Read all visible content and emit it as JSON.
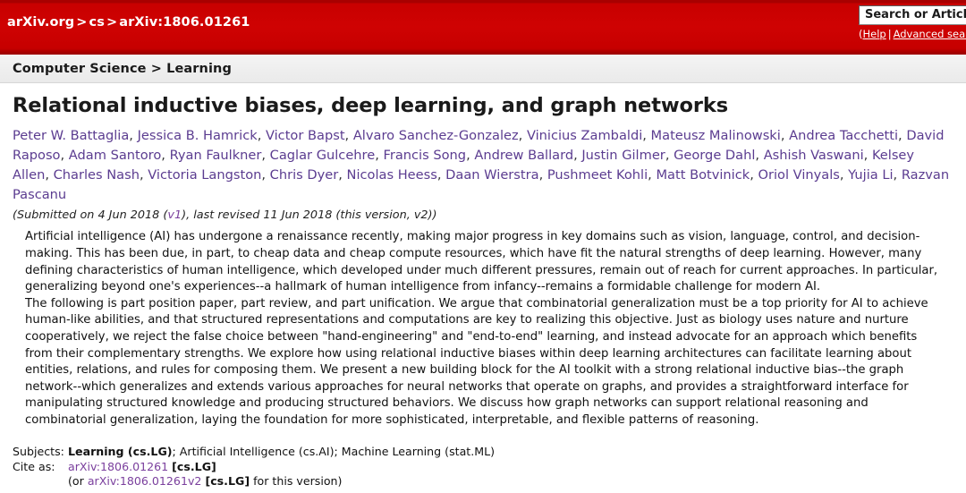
{
  "header": {
    "breadcrumb": {
      "site": "arXiv.org",
      "sep1": ">",
      "archive": "cs",
      "sep2": ">",
      "identifier": "arXiv:1806.01261"
    },
    "search": {
      "value": "Search or Article-id",
      "open_paren": "(",
      "help_label": "Help",
      "pipe": "|",
      "advanced_label": "Advanced search"
    }
  },
  "subject_bar": {
    "text": "Computer Science > Learning"
  },
  "paper": {
    "title": "Relational inductive biases, deep learning, and graph networks",
    "authors": [
      "Peter W. Battaglia",
      "Jessica B. Hamrick",
      "Victor Bapst",
      "Alvaro Sanchez-Gonzalez",
      "Vinicius Zambaldi",
      "Mateusz Malinowski",
      "Andrea Tacchetti",
      "David Raposo",
      "Adam Santoro",
      "Ryan Faulkner",
      "Caglar Gulcehre",
      "Francis Song",
      "Andrew Ballard",
      "Justin Gilmer",
      "George Dahl",
      "Ashish Vaswani",
      "Kelsey Allen",
      "Charles Nash",
      "Victoria Langston",
      "Chris Dyer",
      "Nicolas Heess",
      "Daan Wierstra",
      "Pushmeet Kohli",
      "Matt Botvinick",
      "Oriol Vinyals",
      "Yujia Li",
      "Razvan Pascanu"
    ],
    "submitted": {
      "prefix": "(Submitted on 4 Jun 2018 (",
      "v1_link": "v1",
      "suffix": "), last revised 11 Jun 2018 (this version, v2))"
    },
    "abstract": [
      "Artificial intelligence (AI) has undergone a renaissance recently, making major progress in key domains such as vision, language, control, and decision-making. This has been due, in part, to cheap data and cheap compute resources, which have fit the natural strengths of deep learning. However, many defining characteristics of human intelligence, which developed under much different pressures, remain out of reach for current approaches. In particular, generalizing beyond one's experiences--a hallmark of human intelligence from infancy--remains a formidable challenge for modern AI.",
      "The following is part position paper, part review, and part unification. We argue that combinatorial generalization must be a top priority for AI to achieve human-like abilities, and that structured representations and computations are key to realizing this objective. Just as biology uses nature and nurture cooperatively, we reject the false choice between \"hand-engineering\" and \"end-to-end\" learning, and instead advocate for an approach which benefits from their complementary strengths. We explore how using relational inductive biases within deep learning architectures can facilitate learning about entities, relations, and rules for composing them. We present a new building block for the AI toolkit with a strong relational inductive bias--the graph network--which generalizes and extends various approaches for neural networks that operate on graphs, and provides a straightforward interface for manipulating structured knowledge and producing structured behaviors. We discuss how graph networks can support relational reasoning and combinatorial generalization, laying the foundation for more sophisticated, interpretable, and flexible patterns of reasoning."
    ]
  },
  "metadata": {
    "subjects_label": "Subjects:",
    "subjects_primary": "Learning (cs.LG)",
    "subjects_rest": "; Artificial Intelligence (cs.AI); Machine Learning (stat.ML)",
    "cite_label": "Cite as:",
    "cite_link": "arXiv:1806.01261",
    "cite_tag": "[cs.LG]",
    "cite_version_prefix": "(or ",
    "cite_version_link": "arXiv:1806.01261v2",
    "cite_version_tag": "[cs.LG]",
    "cite_version_suffix": " for this version)"
  },
  "colors": {
    "header_red": "#cc0000",
    "author_purple": "#5b3c90",
    "link_purple": "#7a3f9d",
    "subject_bar_gray": "#f0f0f0"
  }
}
